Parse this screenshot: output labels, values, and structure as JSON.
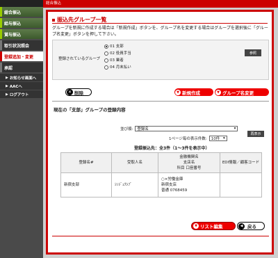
{
  "sidebar": {
    "items": [
      {
        "label": "総合振込"
      },
      {
        "label": "給与振込"
      },
      {
        "label": "賞与振込"
      },
      {
        "label": "取引状況照会"
      },
      {
        "label": "登録追加・変更"
      },
      {
        "label": "承認"
      }
    ],
    "subs": [
      {
        "label": "お知らせ画面へ"
      },
      {
        "label": "AACへ"
      },
      {
        "label": "ログアウト"
      }
    ]
  },
  "topbar": {
    "title": "総合振込"
  },
  "panel": {
    "title": "振込先グループ一覧",
    "desc": "グループを新規に作成する場合は「新規作成」ボタンを、グループ名を変更する場合はグループを選択後に「グループ名変更」ボタンを押して下さい。",
    "group_label": "登録されているグループ",
    "groups": [
      "01 支部",
      "02 役員手当",
      "03 業者",
      "04 月末払い"
    ],
    "ref_label": "参照",
    "delete_label": "削除",
    "new_label": "新規作成",
    "rename_label": "グループ名変更",
    "section_title": "現在の「支部」グループの登録内容",
    "sort_label": "並び順:",
    "sort_value": "登録名",
    "count_label": "1ページ毎の表示件数:",
    "count_value": "10件",
    "redisplay_label": "再表示",
    "summary": "登録振込先：全3件（1〜3件を表示中）",
    "columns": [
      "登録名#",
      "受取人名",
      "金融機関名\n支店名\n科目 口座番号",
      "EDI情報／顧客コード"
    ],
    "rows": [
      {
        "name": "新宿支部",
        "payee": "ｼﾝｼﾞｭｸｼﾌﾞ",
        "bank": "○×労働金庫",
        "branch": "新宿支店",
        "account": "普通 0768459",
        "edi": ""
      }
    ],
    "list_edit_label": "リスト編集",
    "back_label": "戻る"
  }
}
